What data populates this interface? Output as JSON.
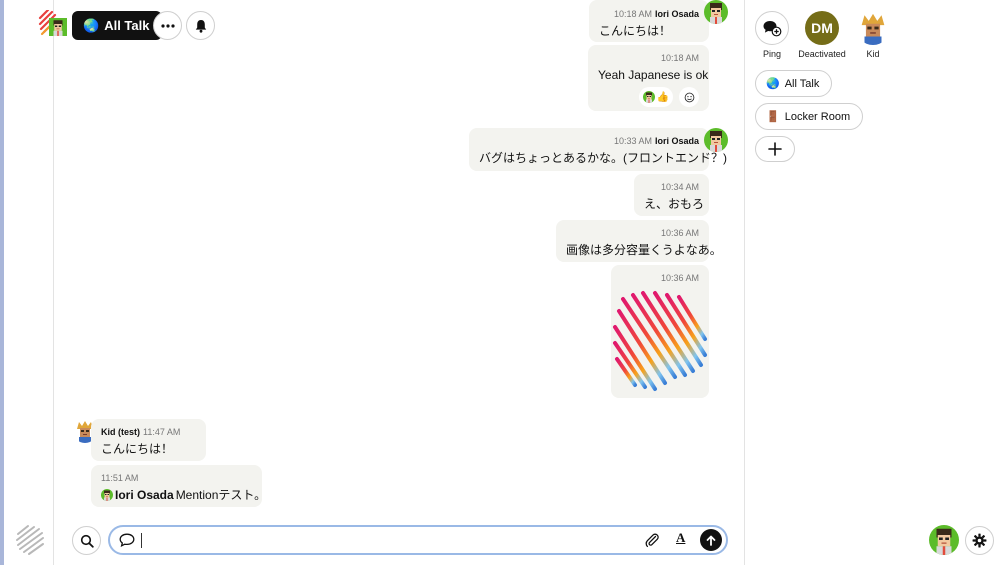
{
  "header": {
    "room_label": "All Talk",
    "room_icon": "🌏"
  },
  "messages": [
    {
      "time": "10:18 AM",
      "author": "Iori Osada",
      "text": "こんにちは！"
    },
    {
      "time": "10:18 AM",
      "text": "Yeah Japanese is ok",
      "reaction_emoji": "👍"
    },
    {
      "time": "10:33 AM",
      "author": "Iori Osada",
      "text": "バグはちょっとあるかな。(フロントエンド？)"
    },
    {
      "time": "10:34 AM",
      "text": "え、おもろ"
    },
    {
      "time": "10:36 AM",
      "text": "画像は多分容量くうよなあ。"
    },
    {
      "time": "10:36 AM",
      "image": "gradient-strokes-image"
    },
    {
      "time": "11:47 AM",
      "author": "Kid (test)",
      "text": "こんにちは！"
    },
    {
      "time": "11:51 AM",
      "mention": "Iori Osada",
      "text": " Mentionテスト。"
    }
  ],
  "composer": {
    "value": "",
    "format_label": "A"
  },
  "sidebar": {
    "quick": [
      {
        "label": "Ping",
        "icon": "chat-plus-icon"
      },
      {
        "label": "Deactivated",
        "initials": "DM",
        "color": "#756d18"
      },
      {
        "label": "Kid"
      }
    ],
    "rooms": [
      {
        "icon": "🌏",
        "label": "All Talk"
      },
      {
        "icon": "🚪",
        "label": "Locker Room"
      }
    ]
  },
  "colors": {
    "bubble": "#f3f3ef",
    "composer_border": "#9ab9e6",
    "accent_dark": "#111111"
  }
}
